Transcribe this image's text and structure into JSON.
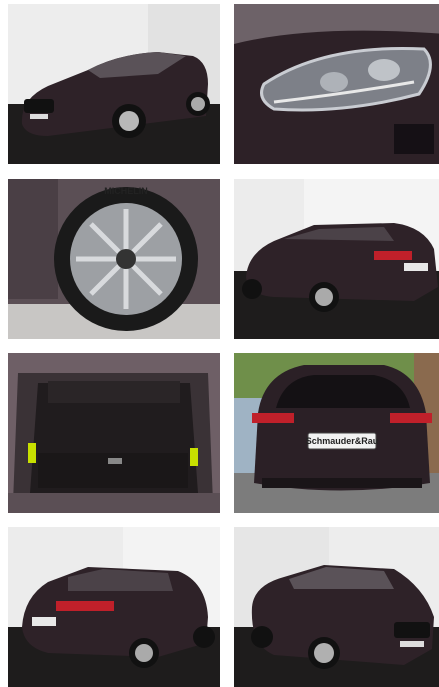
{
  "gallery": {
    "photos": [
      {
        "view": "front three-quarter, studio",
        "icon": "car-front-angle"
      },
      {
        "view": "headlight close-up",
        "icon": "headlight"
      },
      {
        "view": "alloy wheel close-up",
        "icon": "wheel"
      },
      {
        "view": "rear three-quarter, studio",
        "icon": "car-rear-angle"
      },
      {
        "view": "open boot / trunk",
        "icon": "trunk"
      },
      {
        "view": "rear outdoor with dealer plate",
        "icon": "car-rear"
      },
      {
        "view": "rear three-quarter, studio",
        "icon": "car-rear-angle"
      },
      {
        "view": "front three-quarter, studio",
        "icon": "car-front-angle"
      }
    ],
    "tire_brand": "MICHELIN",
    "dealer_plate": "Schmauder&Rau",
    "colors": {
      "car_body": "#2b2026",
      "studio_wall": "#ececec",
      "studio_floor": "#1c1a1a"
    }
  }
}
